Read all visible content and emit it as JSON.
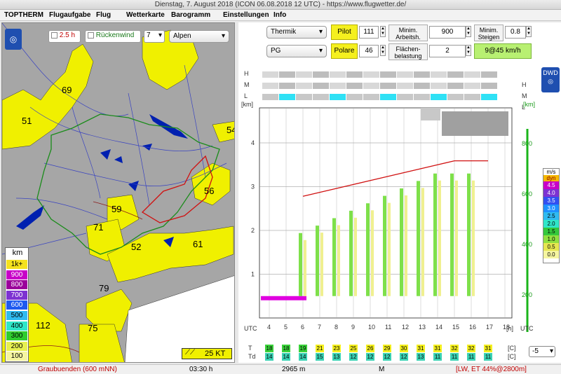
{
  "window": {
    "title": "Dienstag, 7. August 2018 (ICON 06.08.2018 12 UTC) - https://www.flugwetter.de/"
  },
  "menu": {
    "items": [
      "TOPTHERM",
      "Flugaufgabe",
      "Flug",
      "Wetterkarte",
      "Barogramm",
      "Einstellungen",
      "Info"
    ]
  },
  "map": {
    "toolbar": {
      "time_check_label": "2.5 h",
      "tailwind_label": "Rückenwind",
      "level_value": "7",
      "region_value": "Alpen"
    },
    "labels": [
      "69",
      "51",
      "54",
      "56",
      "59",
      "71",
      "52",
      "61",
      "79",
      "112",
      "75"
    ],
    "legend_unit": "km",
    "legend": [
      {
        "label": "1k+",
        "color": "#f5e21e"
      },
      {
        "label": "900",
        "color": "#c800c8"
      },
      {
        "label": "800",
        "color": "#9b009b"
      },
      {
        "label": "700",
        "color": "#7d32d2"
      },
      {
        "label": "600",
        "color": "#1e5af0"
      },
      {
        "label": "500",
        "color": "#2fbaf0"
      },
      {
        "label": "400",
        "color": "#2fe6c8"
      },
      {
        "label": "300",
        "color": "#2ecc2e"
      },
      {
        "label": "200",
        "color": "#e6f050"
      },
      {
        "label": "100",
        "color": "#f5f5a0"
      }
    ],
    "wind_scale_label": "25 KT"
  },
  "params": {
    "thermik": "Thermik",
    "pg": "PG",
    "pilot": "Pilot",
    "polare": "Polare",
    "pilot_value": "111",
    "polare_value": "46",
    "min_arbeitsh_label": "Minim. Arbeitsh.",
    "min_arbeitsh_value": "900",
    "flaechen_label": "Flächen-belastung",
    "flaechen_value": "2",
    "min_steigen_label": "Minim. Steigen",
    "min_steigen_value": "0.8",
    "result": "9@45 km/h"
  },
  "chart": {
    "dwd": "DWD",
    "km_label": "[km]",
    "km_label_right": "[km]",
    "ms_label": "m/s",
    "dyn_label": "dyn",
    "h_label": "H",
    "m_label": "M",
    "l_label": "L",
    "utc_label": "UTC",
    "h_unit": "[h]",
    "t_label": "T",
    "td_label": "Td",
    "c_label": "[C]",
    "offset_value": "-5"
  },
  "chart_data": {
    "type": "heatmap",
    "x": [
      "4",
      "5",
      "6",
      "7",
      "8",
      "9",
      "10",
      "11",
      "12",
      "13",
      "14",
      "15",
      "16",
      "17",
      "18"
    ],
    "y_km_ticks": [
      "1",
      "2",
      "3",
      "4"
    ],
    "y_right_ticks": [
      "200",
      "400",
      "600",
      "800"
    ],
    "climb_scale": [
      "4.5",
      "4.0",
      "3.5",
      "3.0",
      "2.5",
      "2.0",
      "1.5",
      "1.0",
      "0.5",
      "0.0"
    ],
    "climb_colors": [
      "#c800c8",
      "#7d32d2",
      "#3250f0",
      "#1e90ff",
      "#2fbaf0",
      "#2fe6c8",
      "#34c83c",
      "#90e040",
      "#e6e650",
      "#f5f5a0"
    ],
    "T": [
      "18",
      "18",
      "19",
      "21",
      "23",
      "25",
      "26",
      "29",
      "30",
      "31",
      "31",
      "32",
      "32",
      "31"
    ],
    "Td": [
      "14",
      "14",
      "14",
      "15",
      "13",
      "12",
      "12",
      "12",
      "12",
      "13",
      "11",
      "11",
      "11",
      "11"
    ]
  },
  "status": {
    "location": "Graubuenden (600 mNN)",
    "time": "03:30 h",
    "altitude": "2965 m",
    "mode": "M",
    "info": "[LW, ET  44%@2800m]"
  }
}
